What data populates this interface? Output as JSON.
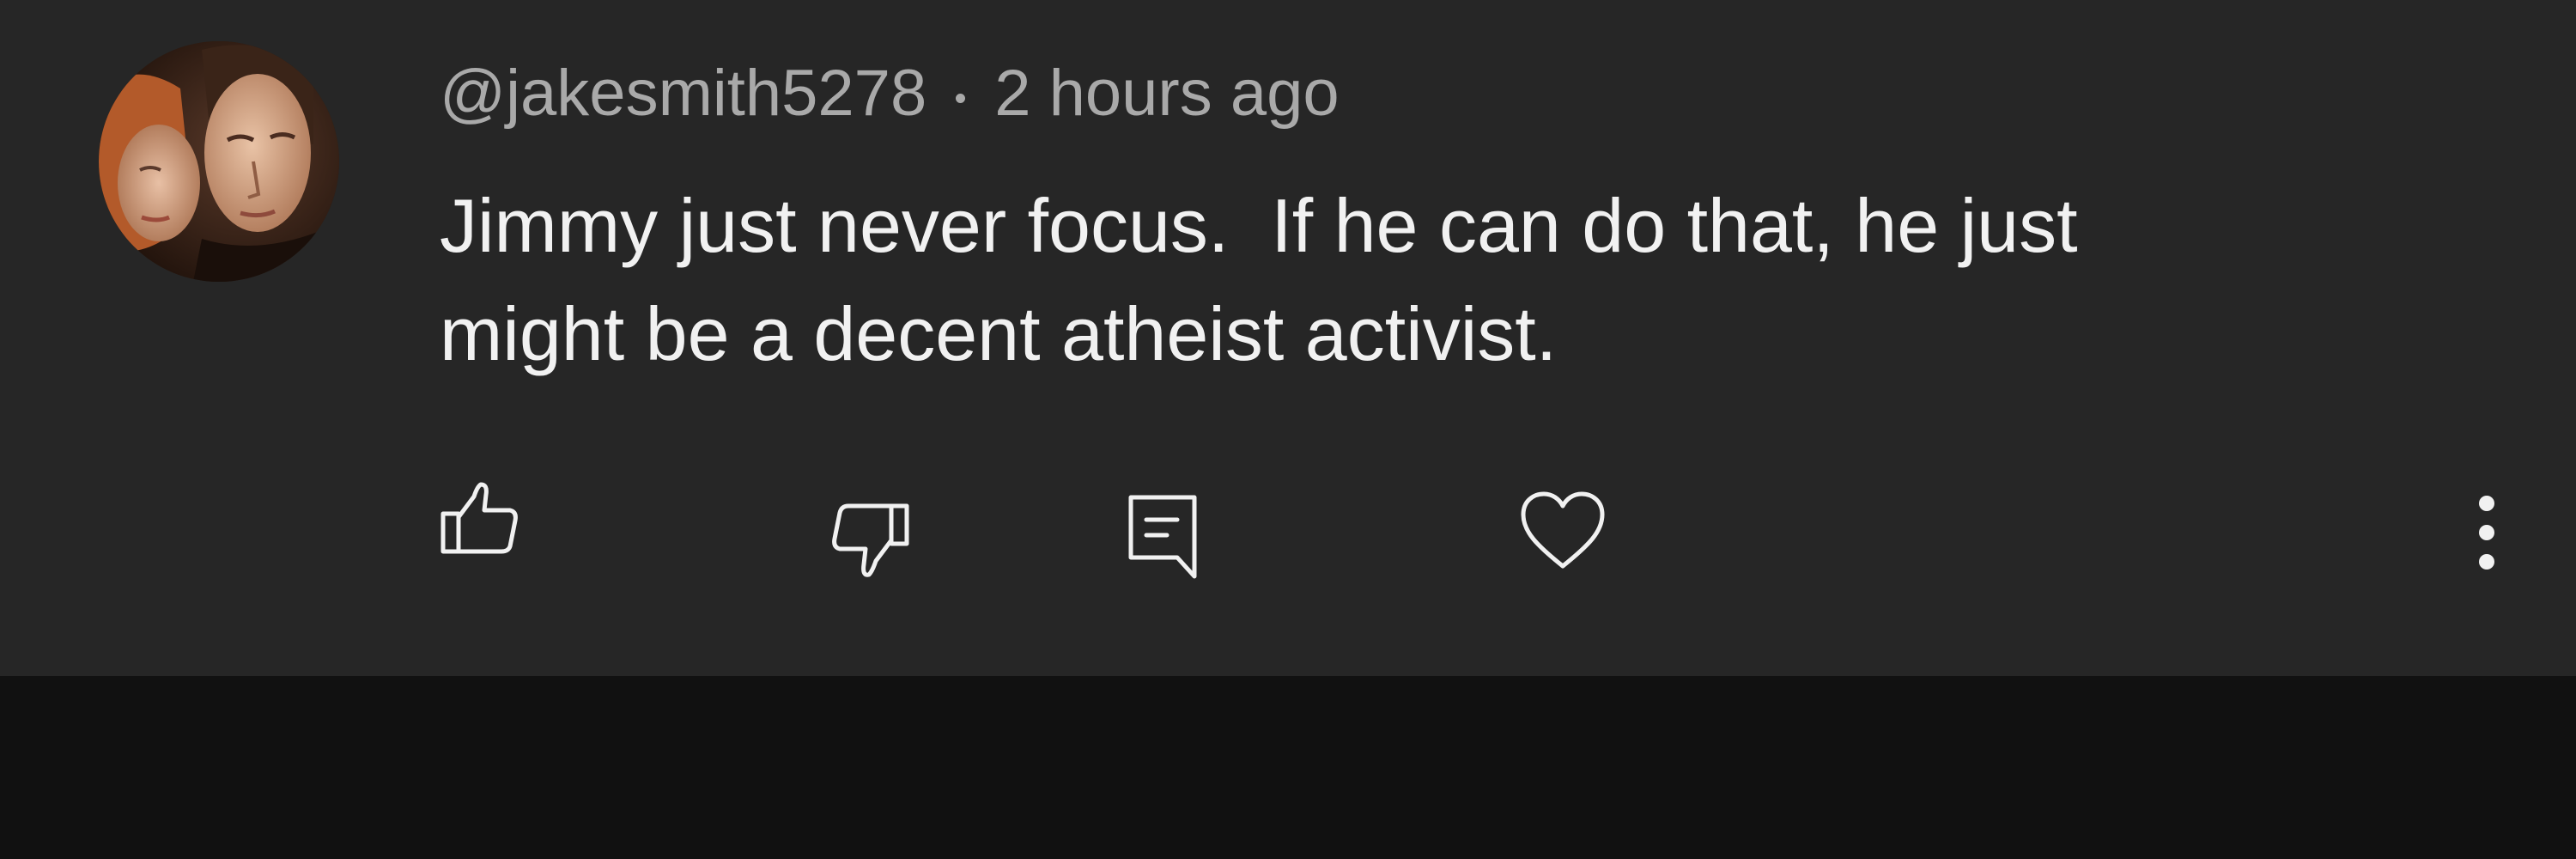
{
  "comment": {
    "author": "@jakesmith5278",
    "timestamp": "2 hours ago",
    "text_lines": [
      "Jimmy just never focus.  If he can do that, he just",
      "might be a decent atheist activist."
    ]
  },
  "actions": {
    "like_icon": "thumbs-up-icon",
    "dislike_icon": "thumbs-down-icon",
    "reply_icon": "comment-bubble-icon",
    "heart_icon": "heart-outline-icon",
    "more_icon": "more-vertical-icon"
  },
  "colors": {
    "card_background": "#262626",
    "page_background": "#111111",
    "meta_text": "#a9a9a9",
    "body_text": "#f1f1f1",
    "icon_stroke": "#f1f1f1"
  }
}
